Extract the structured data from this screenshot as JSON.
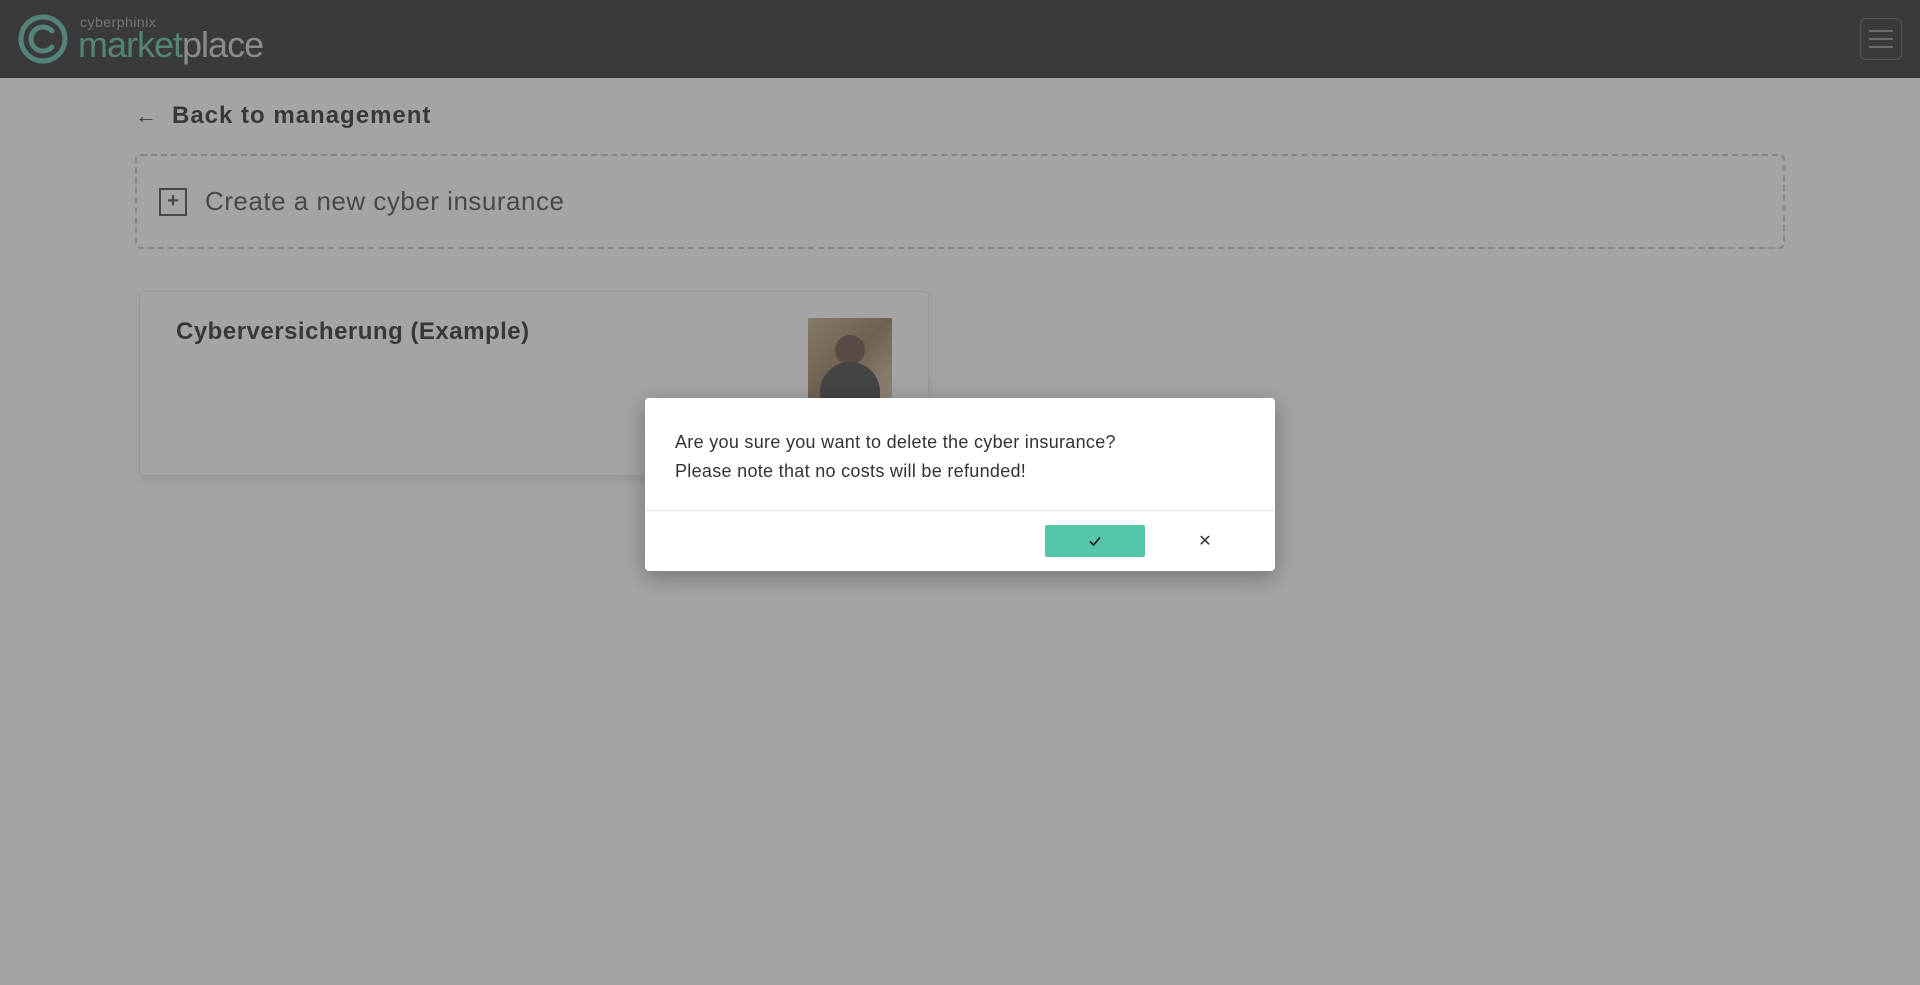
{
  "header": {
    "brand_top": "cyberphinix",
    "brand_main_green": "market",
    "brand_main_gray": "place"
  },
  "page": {
    "back_label": "Back to management",
    "create_label": "Create a new cyber insurance",
    "card_title": "Cyberversicherung (Example)"
  },
  "modal": {
    "line1": "Are you sure you want to delete the cyber insurance?",
    "line2": "Please note that no costs will be refunded!"
  },
  "colors": {
    "accent": "#55c6a9"
  }
}
